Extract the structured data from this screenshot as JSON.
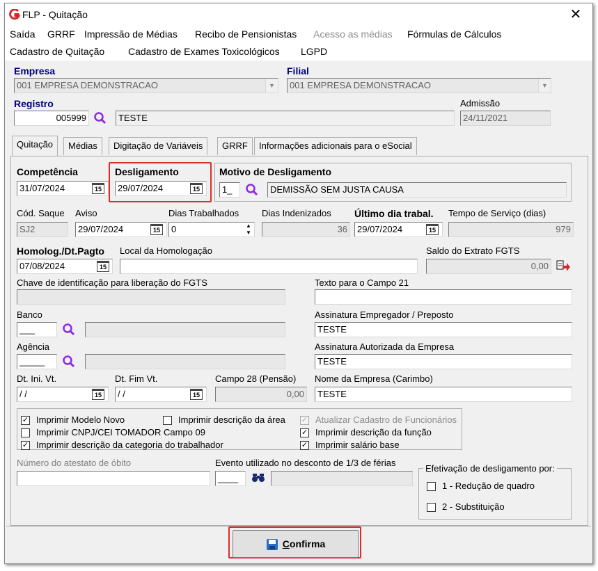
{
  "window": {
    "title": "FLP - Quitação",
    "close_glyph": "✕"
  },
  "menu": [
    "Saída",
    "GRRF",
    "Impressão de Médias",
    "Recibo de Pensionistas",
    "Acesso as médias",
    "Fórmulas de Cálculos",
    "Cadastro de Quitação",
    "Cadastro de Exames Toxicológicos",
    "LGPD"
  ],
  "header": {
    "empresa_label": "Empresa",
    "empresa_value": "001 EMPRESA DEMONSTRACAO",
    "filial_label": "Filial",
    "filial_value": "001 EMPRESA DEMONSTRACAO",
    "registro_label": "Registro",
    "registro_code": "005999",
    "registro_name": "TESTE",
    "admissao_label": "Admissão",
    "admissao_value": "24/11/2021"
  },
  "tabs": [
    "Quitação",
    "Médias",
    "Digitação de Variáveis",
    "GRRF",
    "Informações adicionais para o eSocial"
  ],
  "form": {
    "competencia_label": "Competência",
    "competencia_value": "31/07/2024",
    "desligamento_label": "Desligamento",
    "desligamento_value": "29/07/2024",
    "motivo_label": "Motivo de Desligamento",
    "motivo_code": "1_",
    "motivo_desc": "DEMISSÃO SEM JUSTA CAUSA",
    "cod_saque_label": "Cód. Saque",
    "cod_saque_value": "SJ2",
    "aviso_label": "Aviso",
    "aviso_value": "29/07/2024",
    "dias_trab_label": "Dias Trabalhados",
    "dias_trab_value": "0",
    "dias_inden_label": "Dias Indenizados",
    "dias_inden_value": "36",
    "ultimo_dia_label": "Último dia trabal.",
    "ultimo_dia_value": "29/07/2024",
    "tempo_servico_label": "Tempo de Serviço (dias)",
    "tempo_servico_value": "979",
    "homolog_label": "Homolog./Dt.Pagto",
    "homolog_value": "07/08/2024",
    "local_homolog_label": "Local da Homologação",
    "local_homolog_value": "",
    "saldo_fgts_label": "Saldo do Extrato FGTS",
    "saldo_fgts_value": "0,00",
    "chave_fgts_label": "Chave de identificação para liberação do FGTS",
    "chave_fgts_value": "",
    "texto21_label": "Texto para o Campo 21",
    "texto21_value": "",
    "banco_label": "Banco",
    "banco_value": "___",
    "assinatura_emp_label": "Assinatura Empregador / Preposto",
    "assinatura_emp_value": "TESTE",
    "agencia_label": "Agência",
    "agencia_value": "_____",
    "assinatura_aut_label": "Assinatura Autorizada da Empresa",
    "assinatura_aut_value": "TESTE",
    "dt_ini_vt_label": "Dt. Ini. Vt.",
    "dt_ini_vt_value": " / /",
    "dt_fim_vt_label": "Dt. Fim Vt.",
    "dt_fim_vt_value": " / /",
    "campo28_label": "Campo 28 (Pensão)",
    "campo28_value": "0,00",
    "nome_empresa_label": "Nome da Empresa (Carimbo)",
    "nome_empresa_value": "TESTE",
    "obito_label": "Número do atestato de óbito",
    "obito_value": "",
    "evento_label": "Evento utilizado no desconto de 1/3 de férias",
    "evento_code": "____",
    "evento_desc": ""
  },
  "checkboxes": [
    {
      "label": "Imprimir Modelo Novo",
      "checked": true,
      "disabled": false
    },
    {
      "label": "Imprimir descrição da área",
      "checked": false,
      "disabled": false
    },
    {
      "label": "Atualizar Cadastro de Funcionários",
      "checked": true,
      "disabled": true
    },
    {
      "label": "Imprimir CNPJ/CEI TOMADOR Campo 09",
      "checked": false,
      "disabled": false
    },
    {
      "label": "Imprimir descrição da função",
      "checked": true,
      "disabled": false
    },
    {
      "label": "Imprimir descrição da categoria do trabalhador",
      "checked": true,
      "disabled": false
    },
    {
      "label": "Imprimir salário base",
      "checked": true,
      "disabled": false
    }
  ],
  "efetivacao": {
    "label": "Efetivação de desligamento por:",
    "options": [
      "1 - Redução de quadro",
      "2 - Substituição"
    ]
  },
  "calendar_glyph": "15",
  "check_glyph": "✓",
  "confirm_button": {
    "label_first": "C",
    "label_rest": "onfirma"
  },
  "colors": {
    "highlight": "#e02a2a",
    "section_label_blue": "#000080",
    "search_icon": "#8a2be2"
  }
}
